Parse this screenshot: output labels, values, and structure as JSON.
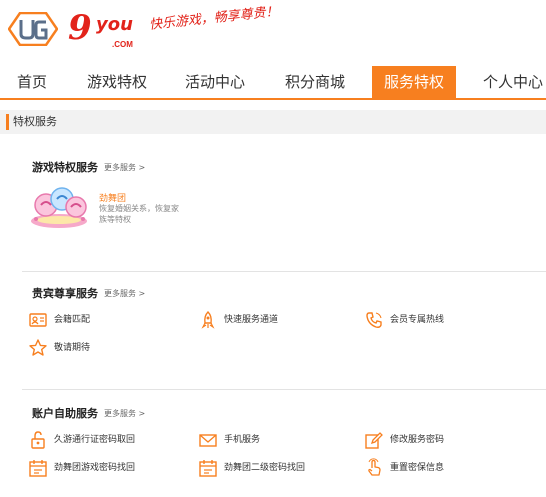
{
  "brand": {
    "ug_logo": "UG",
    "nine_you_logo": "9you",
    "nine_you_domain": ".COM",
    "slogan": "快乐游戏，畅享尊贵！"
  },
  "nav": {
    "items": [
      {
        "label": "首页",
        "active": false
      },
      {
        "label": "游戏特权",
        "active": false
      },
      {
        "label": "活动中心",
        "active": false
      },
      {
        "label": "积分商城",
        "active": false
      },
      {
        "label": "服务特权",
        "active": true
      },
      {
        "label": "个人中心",
        "active": false
      }
    ]
  },
  "breadcrumb": {
    "label": "特权服务"
  },
  "sections": {
    "game": {
      "title": "游戏特权服务",
      "more": "更多服务 >",
      "game_name": "劲舞团",
      "game_desc": "恢复婚姻关系，恢复家族等特权"
    },
    "vip": {
      "title": "贵宾尊享服务",
      "more": "更多服务 >",
      "items": [
        {
          "label": "会籍匹配",
          "icon": "member-card-icon"
        },
        {
          "label": "快速服务通道",
          "icon": "rocket-icon"
        },
        {
          "label": "会员专属热线",
          "icon": "phone-icon"
        },
        {
          "label": "敬请期待",
          "icon": "star-icon"
        }
      ]
    },
    "account": {
      "title": "账户自助服务",
      "more": "更多服务 >",
      "items": [
        {
          "label": "久游通行证密码取回",
          "icon": "lock-icon"
        },
        {
          "label": "手机服务",
          "icon": "envelope-icon"
        },
        {
          "label": "修改服务密码",
          "icon": "edit-icon"
        },
        {
          "label": "劲舞团游戏密码找回",
          "icon": "calendar-icon"
        },
        {
          "label": "劲舞团二级密码找回",
          "icon": "calendar-icon"
        },
        {
          "label": "重置密保信息",
          "icon": "hand-pointer-icon"
        }
      ]
    }
  },
  "colors": {
    "accent": "#f77f1f",
    "brand_red": "#e2231a",
    "logo_blue": "#5b6f8a"
  }
}
